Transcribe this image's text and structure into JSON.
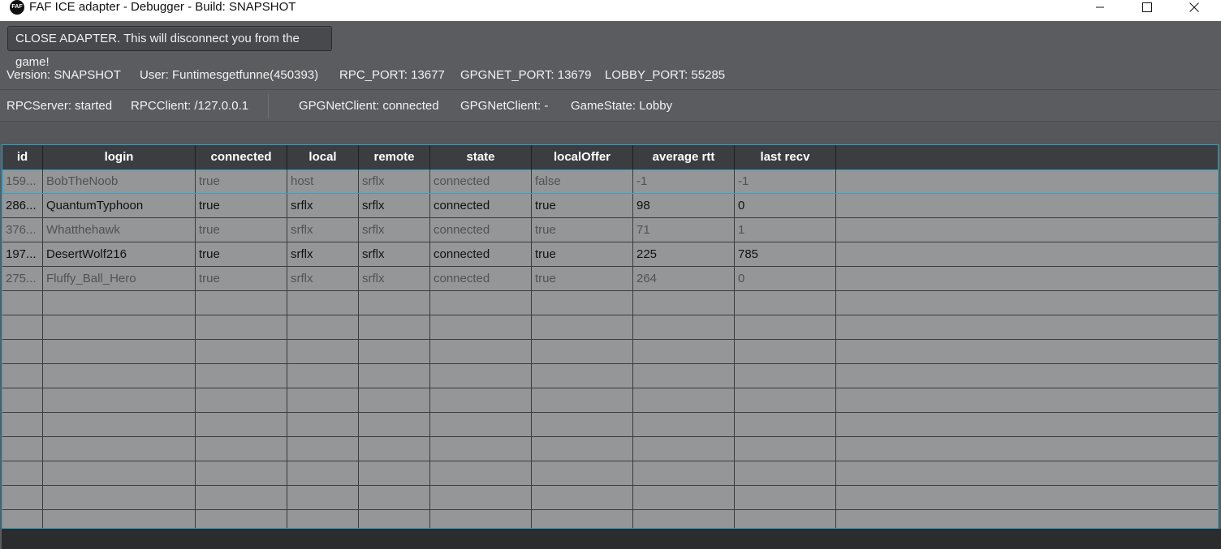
{
  "window": {
    "icon_text": "FAF",
    "title": "FAF ICE adapter - Debugger - Build: SNAPSHOT"
  },
  "close_button": "CLOSE ADAPTER. This will disconnect you from the game!",
  "info": {
    "version": "Version: SNAPSHOT",
    "user": "User: Funtimesgetfunne(450393)",
    "rpc_port": "RPC_PORT: 13677",
    "gpgnet_port": "GPGNET_PORT: 13679",
    "lobby_port": "LOBBY_PORT: 55285"
  },
  "status": {
    "rpc_server": "RPCServer: started",
    "rpc_client": "RPCClient: /127.0.0.1",
    "gpgnet_client_state": "GPGNetClient: connected",
    "gpgnet_client_game": "GPGNetClient: -",
    "game_state": "GameState: Lobby"
  },
  "table": {
    "columns": [
      "id",
      "login",
      "connected",
      "local",
      "remote",
      "state",
      "localOffer",
      "average rtt",
      "last recv"
    ],
    "rows": [
      [
        "159...",
        "BobTheNoob",
        "true",
        "host",
        "srflx",
        "connected",
        "false",
        "-1",
        "-1"
      ],
      [
        "286...",
        "QuantumTyphoon",
        "true",
        "srflx",
        "srflx",
        "connected",
        "true",
        "98",
        "0"
      ],
      [
        "376...",
        "Whatthehawk",
        "true",
        "srflx",
        "srflx",
        "connected",
        "true",
        "71",
        "1"
      ],
      [
        "197...",
        "DesertWolf216",
        "true",
        "srflx",
        "srflx",
        "connected",
        "true",
        "225",
        "785"
      ],
      [
        "275...",
        "Fluffy_Ball_Hero",
        "true",
        "srflx",
        "srflx",
        "connected",
        "true",
        "264",
        "0"
      ]
    ],
    "selected_row": 0,
    "empty_rows": 10
  },
  "colors": {
    "background": "#5a5c5f",
    "header": "#3b3d40",
    "table_body": "#949698",
    "selection_outline": "#2fa3c9"
  }
}
